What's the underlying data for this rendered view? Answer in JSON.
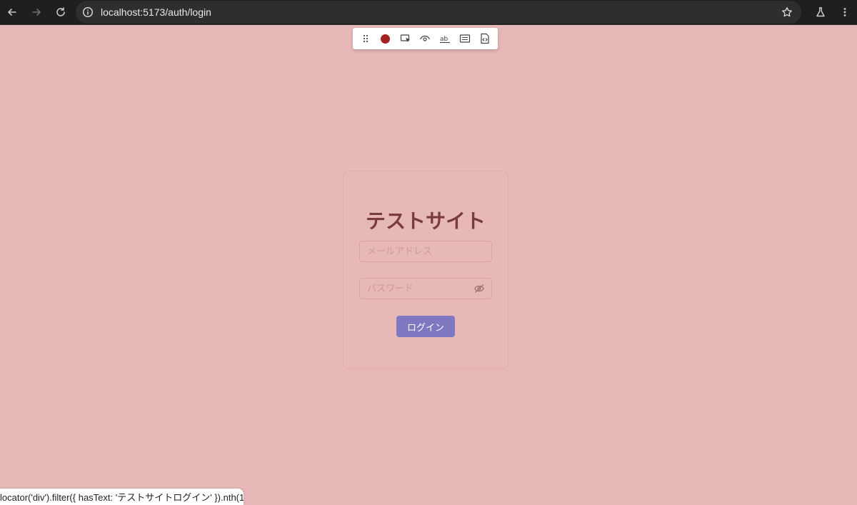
{
  "browser": {
    "url": "localhost:5173/auth/login",
    "icons": {
      "back": "back-arrow-icon",
      "forward": "forward-arrow-icon",
      "reload": "reload-icon",
      "site_info": "info-icon",
      "bookmark": "star-icon",
      "labs": "flask-icon",
      "menu": "kebab-menu-icon"
    }
  },
  "devtoolbar": {
    "tools": [
      "drag-handle-icon",
      "record-icon",
      "pick-locator-icon",
      "assert-visibility-icon",
      "assert-text-icon",
      "assert-value-icon",
      "assert-snapshot-icon"
    ],
    "record_color": "#a3221f"
  },
  "login": {
    "title": "テストサイト",
    "email_placeholder": "メールアドレス",
    "password_placeholder": "パスワード",
    "login_button": "ログイン",
    "accent_color": "#7d78bf"
  },
  "locator_hint": "locator('div').filter({ hasText: 'テストサイトログイン' }).nth(1)"
}
